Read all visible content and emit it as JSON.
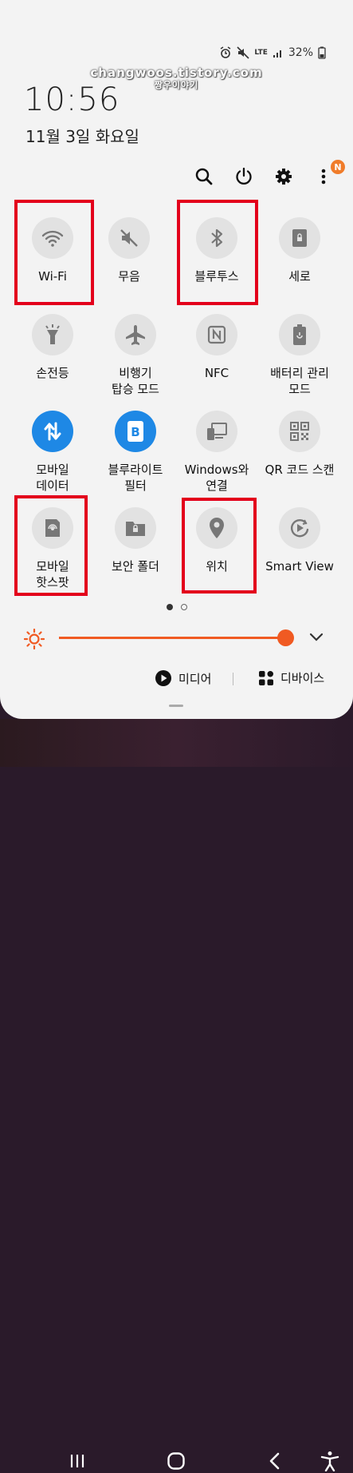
{
  "status": {
    "network": "LTE",
    "battery": "32%"
  },
  "watermark": {
    "line1": "changwoos.tistory.com",
    "line2": "짱우이야기"
  },
  "clock": {
    "time": "10:56",
    "date": "11월 3일 화요일"
  },
  "toolbar": {
    "notification_badge": "N"
  },
  "tiles": [
    {
      "label": "Wi-Fi",
      "icon": "wifi-icon",
      "active": false
    },
    {
      "label": "무음",
      "icon": "mute-icon",
      "active": false
    },
    {
      "label": "블루투스",
      "icon": "bluetooth-icon",
      "active": false
    },
    {
      "label": "세로",
      "icon": "portrait-lock-icon",
      "active": false
    },
    {
      "label": "손전등",
      "icon": "flashlight-icon",
      "active": false
    },
    {
      "label": "비행기\n탑승 모드",
      "icon": "airplane-icon",
      "active": false
    },
    {
      "label": "NFC",
      "icon": "nfc-icon",
      "active": false
    },
    {
      "label": "배터리 관리\n모드",
      "icon": "battery-saver-icon",
      "active": false
    },
    {
      "label": "모바일\n데이터",
      "icon": "mobile-data-icon",
      "active": true
    },
    {
      "label": "블루라이트\n필터",
      "icon": "blue-light-icon",
      "active": true
    },
    {
      "label": "Windows와\n연결",
      "icon": "link-windows-icon",
      "active": false
    },
    {
      "label": "QR 코드 스캔",
      "icon": "qr-icon",
      "active": false
    },
    {
      "label": "모바일\n핫스팟",
      "icon": "hotspot-icon",
      "active": false
    },
    {
      "label": "보안 폴더",
      "icon": "secure-folder-icon",
      "active": false
    },
    {
      "label": "위치",
      "icon": "location-icon",
      "active": false
    },
    {
      "label": "Smart View",
      "icon": "smart-view-icon",
      "active": false
    }
  ],
  "pager": {
    "current_page": 1,
    "total_pages": 2
  },
  "brightness": {
    "level_percent": 100
  },
  "media_button": {
    "label": "미디어"
  },
  "devices_button": {
    "label": "디바이스"
  },
  "colors": {
    "accent": "#f05a22",
    "active_tile": "#1e88e5",
    "highlight": "#e3001b"
  }
}
